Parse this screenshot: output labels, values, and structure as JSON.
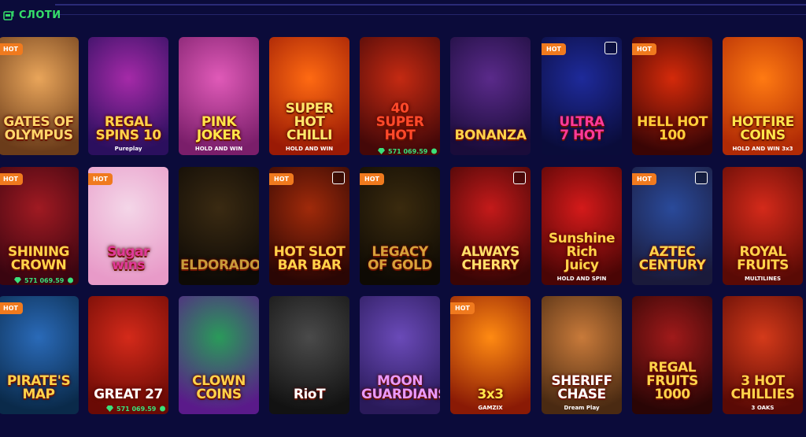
{
  "section": {
    "title": "СЛОТИ",
    "icon": "slot-machine-icon"
  },
  "tiles": [
    {
      "name": "GATES OF\nOLYMPUS",
      "hot": true,
      "box": false,
      "sub": "",
      "bg": [
        "#e9a55a",
        "#6b3c1a"
      ],
      "color": "#ffd76a"
    },
    {
      "name": "REGAL\nSPINS 10",
      "hot": false,
      "box": false,
      "sub": "Pureplay",
      "bg": [
        "#a52aa8",
        "#2b0f5e"
      ],
      "color": "#ffd34a"
    },
    {
      "name": "PINK\nJOKER",
      "hot": false,
      "box": false,
      "sub": "HOLD AND WIN",
      "bg": [
        "#e05ab8",
        "#7a1e6a"
      ],
      "color": "#ffe64a"
    },
    {
      "name": "SUPER HOT\nCHILLI",
      "hot": false,
      "box": false,
      "sub": "HOLD AND WIN",
      "bg": [
        "#ff6a12",
        "#9a1a05"
      ],
      "color": "#ffe86a"
    },
    {
      "name": "40\nSUPER\nHOT",
      "hot": false,
      "box": false,
      "sub": "",
      "bg": [
        "#c42a12",
        "#450808"
      ],
      "color": "#ff4a2a"
    },
    {
      "name": "BONANZA",
      "hot": false,
      "box": false,
      "sub": "",
      "bg": [
        "#5a2a8a",
        "#1a0c3a"
      ],
      "color": "#ffd34a"
    },
    {
      "name": "ULTRA\n7 HOT",
      "hot": true,
      "box": true,
      "sub": "",
      "bg": [
        "#1e2a9a",
        "#0a0c3a"
      ],
      "color": "#ff3a9a"
    },
    {
      "name": "HELL HOT\n100",
      "hot": true,
      "box": false,
      "sub": "",
      "bg": [
        "#d42a0a",
        "#3a0505"
      ],
      "color": "#ffcf3a"
    },
    {
      "name": "HOTFIRE\nCOINS",
      "hot": false,
      "box": false,
      "sub": "HOLD AND WIN 3x3",
      "bg": [
        "#ff7a12",
        "#b02a05"
      ],
      "color": "#ffe64a"
    },
    {
      "name": "SHINING CROWN",
      "hot": true,
      "box": false,
      "sub": "",
      "bg": [
        "#a01a22",
        "#3a0510"
      ],
      "color": "#ffd34a"
    },
    {
      "name": "Sugar\nwins",
      "hot": true,
      "box": false,
      "sub": "",
      "bg": [
        "#f4d6e8",
        "#e89ac8"
      ],
      "color": "#e03a9a"
    },
    {
      "name": "ELDORADO",
      "hot": false,
      "box": false,
      "sub": "",
      "bg": [
        "#3a2a12",
        "#0e0a06"
      ],
      "color": "#c89a3a"
    },
    {
      "name": "HOT SLOT\nBAR BAR",
      "hot": true,
      "box": true,
      "sub": "",
      "bg": [
        "#a02a0a",
        "#2a0604"
      ],
      "color": "#ffd34a"
    },
    {
      "name": "LEGACY OF GOLD",
      "hot": true,
      "box": false,
      "sub": "",
      "bg": [
        "#3a2a0e",
        "#0e0a04"
      ],
      "color": "#d8a23a"
    },
    {
      "name": "ALWAYS\nCHERRY",
      "hot": false,
      "box": true,
      "sub": "",
      "bg": [
        "#c41a1a",
        "#3a0505"
      ],
      "color": "#ffe06a"
    },
    {
      "name": "Sunshine Rich\nJuicy",
      "hot": false,
      "box": false,
      "sub": "HOLD AND SPIN",
      "bg": [
        "#d41a1a",
        "#4a0505"
      ],
      "color": "#ffd34a"
    },
    {
      "name": "AZTEC CENTURY",
      "hot": true,
      "box": true,
      "sub": "",
      "bg": [
        "#2a4a9a",
        "#1a1a3a"
      ],
      "color": "#ffd34a"
    },
    {
      "name": "ROYAL\nFRUITS",
      "hot": false,
      "box": false,
      "sub": "MULTILINES",
      "bg": [
        "#d42a1a",
        "#5a0a05"
      ],
      "color": "#ffd34a"
    },
    {
      "name": "PIRATE'S\nMAP",
      "hot": true,
      "box": false,
      "sub": "",
      "bg": [
        "#2a6ab8",
        "#0a2a4a"
      ],
      "color": "#ffd34a"
    },
    {
      "name": "GREAT 27",
      "hot": false,
      "box": false,
      "sub": "",
      "bg": [
        "#d42a1a",
        "#6a0a05"
      ],
      "color": "#ffffff"
    },
    {
      "name": "CLOWN COINS",
      "hot": false,
      "box": false,
      "sub": "",
      "bg": [
        "#2a9a5a",
        "#5a1a8a"
      ],
      "color": "#ffd34a"
    },
    {
      "name": "RioT",
      "hot": false,
      "box": false,
      "sub": "",
      "bg": [
        "#4a4a4a",
        "#121212"
      ],
      "color": "#ffffff"
    },
    {
      "name": "MOON\nGUARDIANS",
      "hot": false,
      "box": false,
      "sub": "",
      "bg": [
        "#6a4ab8",
        "#2a1a5a"
      ],
      "color": "#e89aff"
    },
    {
      "name": "3x3",
      "hot": true,
      "box": false,
      "sub": "GAMZIX",
      "bg": [
        "#ff8a12",
        "#8a1a05"
      ],
      "color": "#ffe64a"
    },
    {
      "name": "SHERIFF\nCHASE",
      "hot": false,
      "box": false,
      "sub": "Dream Play",
      "bg": [
        "#c87a3a",
        "#4a2a12"
      ],
      "color": "#ffffff"
    },
    {
      "name": "REGAL\nFRUITS\n1000",
      "hot": false,
      "box": false,
      "sub": "",
      "bg": [
        "#a01a1a",
        "#2a0505"
      ],
      "color": "#ffd34a"
    },
    {
      "name": "3 HOT\nCHILLIES",
      "hot": false,
      "box": false,
      "sub": "3 OAKS",
      "bg": [
        "#d43a1a",
        "#5a0a05"
      ],
      "color": "#ffd34a"
    }
  ],
  "jackpots": [
    {
      "value": "571 069.59",
      "color": "#3be07a"
    },
    {
      "value": "571 069.59",
      "color": "#3be07a"
    },
    {
      "value": "571 069.59",
      "color": "#3be07a"
    }
  ]
}
